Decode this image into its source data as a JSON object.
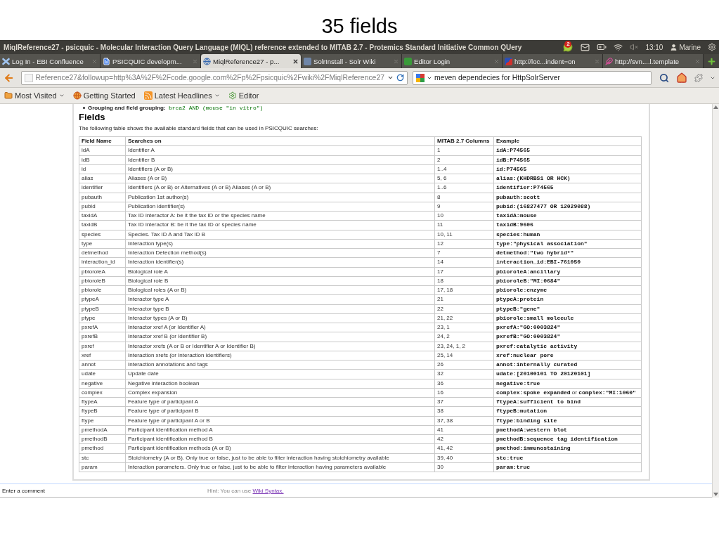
{
  "slide": {
    "title": "35 fields"
  },
  "window": {
    "title": "MiqlReference27 - psicquic - Molecular Interaction Query Language (MIQL) reference extended to MITAB 2.7 - Protemics Standard Initiative Common QUery",
    "indicators": {
      "badge": "2",
      "clock": "13:10",
      "user": "Marine"
    }
  },
  "tabs": [
    {
      "label": "Log In - EBI Confluence",
      "kind": "cross",
      "selected": false
    },
    {
      "label": "PSICQUIC developm...",
      "kind": "document",
      "selected": false
    },
    {
      "label": "MiqlReference27 - p...",
      "kind": "globe",
      "selected": true
    },
    {
      "label": "SolrInstall - Solr Wiki",
      "kind": "tile",
      "selected": false
    },
    {
      "label": "Editor Login",
      "kind": "square",
      "selected": false
    },
    {
      "label": "http://loc...indent=on",
      "kind": "split",
      "selected": false
    },
    {
      "label": "http://svn....l.template",
      "kind": "feather",
      "selected": false
    }
  ],
  "nav": {
    "url": "Reference27&followup=http%3A%2F%2Fcode.google.com%2Fp%2Fpsicquic%2Fwiki%2FMiqlReference27",
    "search": "meven dependecies for HttpSolrServer"
  },
  "bookmarks": [
    {
      "label": "Most Visited",
      "kind": "folder",
      "menu": true
    },
    {
      "label": "Getting Started",
      "kind": "globe",
      "menu": false
    },
    {
      "label": "Latest Headlines",
      "kind": "rss",
      "menu": true
    },
    {
      "label": "Editor",
      "kind": "gear",
      "menu": false
    }
  ],
  "page": {
    "cut_item": {
      "label": "Grouping and field grouping:",
      "code": "brca2 AND (mouse \"in vitro\")"
    },
    "heading": "Fields",
    "intro": "The following table shows the available standard fields that can be used in PSICQUIC searches:",
    "table": {
      "columns": [
        "Field Name",
        "Searches on",
        "MITAB 2.7 Columns",
        "Example"
      ],
      "rows": [
        {
          "field": "idA",
          "searches_on": "Identifier A",
          "columns": "1",
          "example": [
            {
              "kind": "code",
              "text": "idA:P74565"
            }
          ]
        },
        {
          "field": "idB",
          "searches_on": "Identifier B",
          "columns": "2",
          "example": [
            {
              "kind": "code",
              "text": "idB:P74565"
            }
          ]
        },
        {
          "field": "id",
          "searches_on": "Identifiers (A or B)",
          "columns": "1..4",
          "example": [
            {
              "kind": "code",
              "text": "id:P74565"
            }
          ]
        },
        {
          "field": "alias",
          "searches_on": "Aliases (A or B)",
          "columns": "5, 6",
          "example": [
            {
              "kind": "code",
              "text": "alias:(KHDRBS1 OR HCK)"
            }
          ]
        },
        {
          "field": "identifier",
          "searches_on": "Identifiers (A or B) or Alternatives (A or B) Aliases (A or B)",
          "columns": "1..6",
          "example": [
            {
              "kind": "code",
              "text": "identifier:P74565"
            }
          ]
        },
        {
          "field": "pubauth",
          "searches_on": "Publication 1st author(s)",
          "columns": "8",
          "example": [
            {
              "kind": "code",
              "text": "pubauth:scott"
            }
          ]
        },
        {
          "field": "pubid",
          "searches_on": "Publication identifier(s)",
          "columns": "9",
          "example": [
            {
              "kind": "code",
              "text": "pubid:(16827477 OR 12029088)"
            }
          ]
        },
        {
          "field": "taxidA",
          "searches_on": "Tax ID interactor A: be it the tax ID or the species name",
          "columns": "10",
          "example": [
            {
              "kind": "code",
              "text": "taxidA:mouse"
            }
          ]
        },
        {
          "field": "taxidB",
          "searches_on": "Tax ID interactor B: be it the tax ID or species name",
          "columns": "11",
          "example": [
            {
              "kind": "code",
              "text": "taxidB:9606"
            }
          ]
        },
        {
          "field": "species",
          "searches_on": "Species. Tax ID A and Tax ID B",
          "columns": "10, 11",
          "example": [
            {
              "kind": "code",
              "text": "species:human"
            }
          ]
        },
        {
          "field": "type",
          "searches_on": "Interaction type(s)",
          "columns": "12",
          "example": [
            {
              "kind": "code",
              "text": "type:\"physical association\""
            }
          ]
        },
        {
          "field": "detmethod",
          "searches_on": "Interaction Detection method(s)",
          "columns": "7",
          "example": [
            {
              "kind": "code",
              "text": "detmethod:\"two hybrid*\""
            }
          ]
        },
        {
          "field": "interaction_id",
          "searches_on": "Interaction identifier(s)",
          "columns": "14",
          "example": [
            {
              "kind": "code",
              "text": "interaction_id:EBI-761050"
            }
          ]
        },
        {
          "field": "pbioroleA",
          "searches_on": "Biological role A",
          "columns": "17",
          "example": [
            {
              "kind": "code",
              "text": "pbioroleA:ancillary"
            }
          ]
        },
        {
          "field": "pbioroleB",
          "searches_on": "Biological role B",
          "columns": "18",
          "example": [
            {
              "kind": "code",
              "text": "pbioroleB:\"MI:0684\""
            }
          ]
        },
        {
          "field": "pbiorole",
          "searches_on": "Biological roles (A or B)",
          "columns": "17, 18",
          "example": [
            {
              "kind": "code",
              "text": "pbiorole:enzyme"
            }
          ]
        },
        {
          "field": "ptypeA",
          "searches_on": "Interactor type A",
          "columns": "21",
          "example": [
            {
              "kind": "code",
              "text": "ptypeA:protein"
            }
          ]
        },
        {
          "field": "ptypeB",
          "searches_on": "Interactor type B",
          "columns": "22",
          "example": [
            {
              "kind": "code",
              "text": "ptypeB:\"gene\""
            }
          ]
        },
        {
          "field": "ptype",
          "searches_on": "Interactor types (A or B)",
          "columns": "21, 22",
          "example": [
            {
              "kind": "code",
              "text": "pbiorole:small molecule"
            }
          ]
        },
        {
          "field": "pxrefA",
          "searches_on": "Interactor xref A (or Identifier A)",
          "columns": "23, 1",
          "example": [
            {
              "kind": "code",
              "text": "pxrefA:\"GO:0003824\""
            }
          ]
        },
        {
          "field": "pxrefB",
          "searches_on": "Interactor xref B (or Identifier B)",
          "columns": "24, 2",
          "example": [
            {
              "kind": "code",
              "text": "pxrefB:\"GO:0003824\""
            }
          ]
        },
        {
          "field": "pxref",
          "searches_on": "Interactor xrefs (A or B or Identifier A or Identifier B)",
          "columns": "23, 24, 1, 2",
          "example": [
            {
              "kind": "code",
              "text": "pxref:catalytic activity"
            }
          ]
        },
        {
          "field": "xref",
          "searches_on": "Interaction xrefs (or Interaction identifiers)",
          "columns": "25, 14",
          "example": [
            {
              "kind": "code",
              "text": "xref:nuclear pore"
            }
          ]
        },
        {
          "field": "annot",
          "searches_on": "Interaction annotations and tags",
          "columns": "26",
          "example": [
            {
              "kind": "code",
              "text": "annot:internally curated"
            }
          ]
        },
        {
          "field": "udate",
          "searches_on": "Update date",
          "columns": "32",
          "example": [
            {
              "kind": "code",
              "text": "udate:[20100101 TO 20120101]"
            }
          ]
        },
        {
          "field": "negative",
          "searches_on": "Negative interaction boolean",
          "columns": "36",
          "example": [
            {
              "kind": "code",
              "text": "negative:true"
            }
          ]
        },
        {
          "field": "complex",
          "searches_on": "Complex expansion",
          "columns": "16",
          "example": [
            {
              "kind": "code",
              "text": "complex:spoke expanded"
            },
            {
              "kind": "text",
              "text": "or"
            },
            {
              "kind": "code",
              "text": "complex:\"MI:1060\""
            }
          ]
        },
        {
          "field": "ftypeA",
          "searches_on": "Feature type of participant A",
          "columns": "37",
          "example": [
            {
              "kind": "code",
              "text": "ftypeA:sufficient to bind"
            }
          ]
        },
        {
          "field": "ftypeB",
          "searches_on": "Feature type of participant B",
          "columns": "38",
          "example": [
            {
              "kind": "code",
              "text": "ftypeB:mutation"
            }
          ]
        },
        {
          "field": "ftype",
          "searches_on": "Feature type of participant A or B",
          "columns": "37, 38",
          "example": [
            {
              "kind": "code",
              "text": "ftype:binding site"
            }
          ]
        },
        {
          "field": "pmethodA",
          "searches_on": "Participant identification method A",
          "columns": "41",
          "example": [
            {
              "kind": "code",
              "text": "pmethodA:western blot"
            }
          ]
        },
        {
          "field": "pmethodB",
          "searches_on": "Participant identification method B",
          "columns": "42",
          "example": [
            {
              "kind": "code",
              "text": "pmethodB:sequence tag identification"
            }
          ]
        },
        {
          "field": "pmethod",
          "searches_on": "Participant identification methods (A or B)",
          "columns": "41, 42",
          "example": [
            {
              "kind": "code",
              "text": "pmethod:immunostaining"
            }
          ]
        },
        {
          "field": "stc",
          "searches_on": "Stoichiometry (A or B). Only true or false, just to be able to filter interaction having stoichiometry available",
          "columns": "39, 40",
          "example": [
            {
              "kind": "code",
              "text": "stc:true"
            }
          ]
        },
        {
          "field": "param",
          "searches_on": "Interaction parameters. Only true or false, just to be able to filter interaction having parameters available",
          "columns": "30",
          "example": [
            {
              "kind": "code",
              "text": "param:true"
            }
          ]
        }
      ]
    }
  },
  "comment_bar": {
    "label": "Enter a comment",
    "hint": "Hint: You can use",
    "link": "Wiki Syntax."
  }
}
